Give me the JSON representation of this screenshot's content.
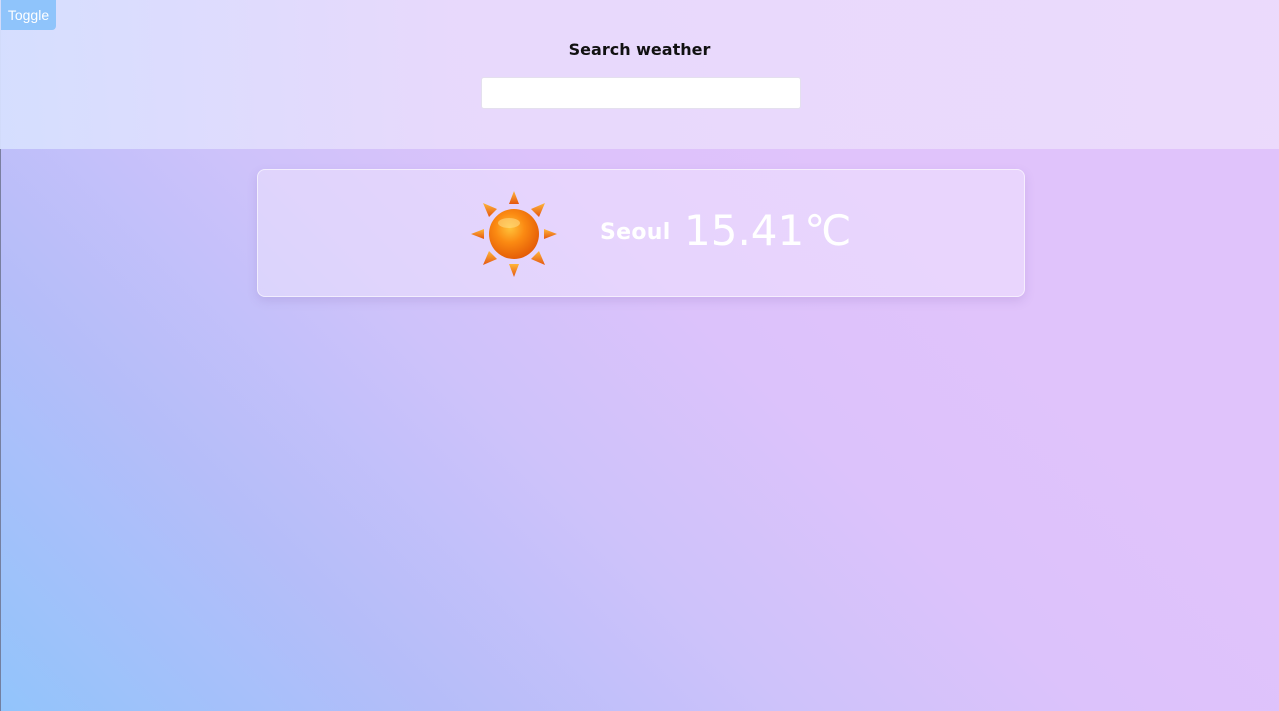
{
  "toolbar": {
    "toggle_label": "Toggle"
  },
  "search": {
    "title": "Search weather",
    "value": "",
    "placeholder": ""
  },
  "weather": {
    "icon": "sun-icon",
    "city": "Seoul",
    "temperature": "15.41℃"
  },
  "colors": {
    "background_start": "#92c4fb",
    "background_end": "#e0c3fb",
    "toggle_button": "#8fc4fb",
    "sun_core": "#f07a0a",
    "sun_rays": "#e8661a"
  }
}
